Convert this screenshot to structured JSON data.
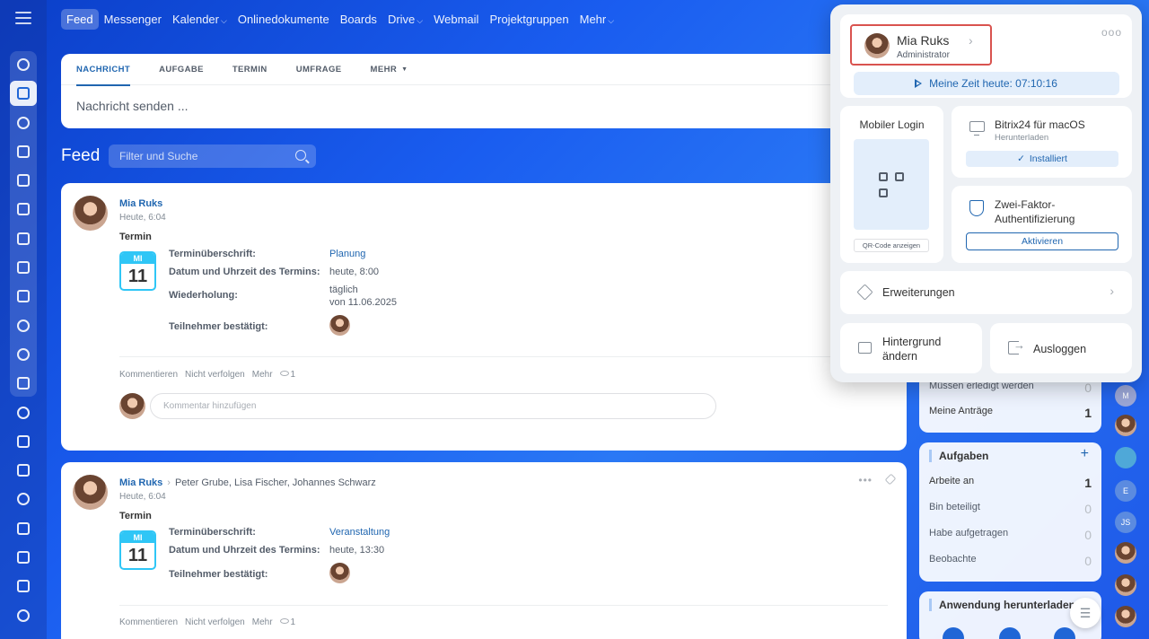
{
  "nav": {
    "items": [
      {
        "label": "Feed",
        "active": true,
        "caret": false
      },
      {
        "label": "Messenger",
        "caret": false
      },
      {
        "label": "Kalender",
        "caret": true
      },
      {
        "label": "Onlinedokumente",
        "caret": false
      },
      {
        "label": "Boards",
        "caret": false
      },
      {
        "label": "Drive",
        "caret": true
      },
      {
        "label": "Webmail",
        "caret": false
      },
      {
        "label": "Projektgruppen",
        "caret": false
      },
      {
        "label": "Mehr",
        "caret": true
      }
    ]
  },
  "composer": {
    "tabs": [
      "NACHRICHT",
      "AUFGABE",
      "TERMIN",
      "UMFRAGE",
      "MEHR"
    ],
    "placeholder": "Nachricht senden ..."
  },
  "feed": {
    "title": "Feed",
    "filter_placeholder": "Filter und Suche"
  },
  "posts": [
    {
      "author": "Mia Ruks",
      "time": "Heute, 6:04",
      "kind": "Termin",
      "cal_month": "MI",
      "cal_day": "11",
      "fields": {
        "title_label": "Terminüberschrift:",
        "title_value": "Planung",
        "date_label": "Datum und Uhrzeit des Termins:",
        "date_value": "heute, 8:00",
        "repeat_label": "Wiederholung:",
        "repeat_value_1": "täglich",
        "repeat_value_2": "von 11.06.2025",
        "participants_label": "Teilnehmer bestätigt:"
      },
      "actions": {
        "comment": "Kommentieren",
        "unfollow": "Nicht verfolgen",
        "more": "Mehr",
        "views": "1"
      },
      "comment_placeholder": "Kommentar hinzufügen"
    },
    {
      "author": "Mia Ruks",
      "recipients": "Peter Grube, Lisa Fischer, Johannes Schwarz",
      "time": "Heute, 6:04",
      "kind": "Termin",
      "cal_month": "MI",
      "cal_day": "11",
      "fields": {
        "title_label": "Terminüberschrift:",
        "title_value": "Veranstaltung",
        "date_label": "Datum und Uhrzeit des Termins:",
        "date_value": "heute, 13:30",
        "participants_label": "Teilnehmer bestätigt:"
      },
      "actions": {
        "comment": "Kommentieren",
        "unfollow": "Nicht verfolgen",
        "more": "Mehr",
        "views": "1"
      }
    }
  ],
  "widgets": {
    "partial_row_1": {
      "label": "Müssen erledigt werden",
      "count": "0"
    },
    "partial_row_2": {
      "label": "Meine Anträge",
      "count": "1"
    },
    "tasks": {
      "title": "Aufgaben",
      "rows": [
        {
          "label": "Arbeite an",
          "count": "1"
        },
        {
          "label": "Bin beteiligt",
          "count": "0"
        },
        {
          "label": "Habe aufgetragen",
          "count": "0"
        },
        {
          "label": "Beobachte",
          "count": "0"
        }
      ]
    },
    "download": {
      "title": "Anwendung herunterladen"
    }
  },
  "right_avatars": [
    "M",
    "",
    "",
    "E",
    "JS",
    "",
    "",
    ""
  ],
  "profile_popup": {
    "name": "Mia Ruks",
    "role": "Administrator",
    "time_today": "Meine Zeit heute: 07:10:16",
    "mobile_login": "Mobiler Login",
    "qr_button": "QR-Code anzeigen",
    "desktop_app": "Bitrix24 für macOS",
    "desktop_sub": "Herunterladen",
    "installed": "Installiert",
    "twofa_1": "Zwei-Faktor-",
    "twofa_2": "Authentifizierung",
    "activate": "Aktivieren",
    "extensions": "Erweiterungen",
    "bg_1": "Hintergrund",
    "bg_2": "ändern",
    "logout": "Ausloggen"
  },
  "colors": {
    "accent": "#2066b0",
    "calendar": "#2fc6f6",
    "highlight_border": "#d9534f"
  }
}
